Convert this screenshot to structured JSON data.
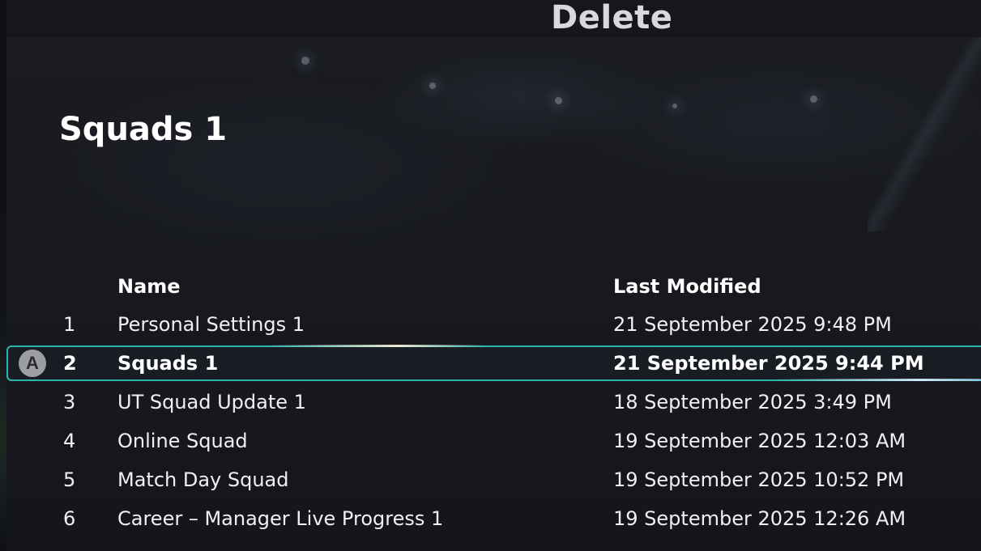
{
  "header": {
    "action_label": "Delete"
  },
  "page": {
    "title": "Squads 1"
  },
  "table": {
    "columns": {
      "name": "Name",
      "last_modified": "Last Modified"
    },
    "selected_index": 1,
    "select_button_label": "A",
    "rows": [
      {
        "num": "1",
        "name": "Personal Settings 1",
        "modified": "21 September 2025 9:48 PM"
      },
      {
        "num": "2",
        "name": "Squads 1",
        "modified": "21 September 2025 9:44 PM"
      },
      {
        "num": "3",
        "name": "UT Squad Update 1",
        "modified": "18 September 2025 3:49 PM"
      },
      {
        "num": "4",
        "name": "Online Squad",
        "modified": "19 September 2025 12:03 AM"
      },
      {
        "num": "5",
        "name": "Match Day Squad",
        "modified": "19 September 2025 10:52 PM"
      },
      {
        "num": "6",
        "name": "Career – Manager Live Progress 1",
        "modified": "19 September 2025 12:26 AM"
      }
    ]
  },
  "colors": {
    "selection_border": "#2fb5b0",
    "background": "#15171d"
  }
}
